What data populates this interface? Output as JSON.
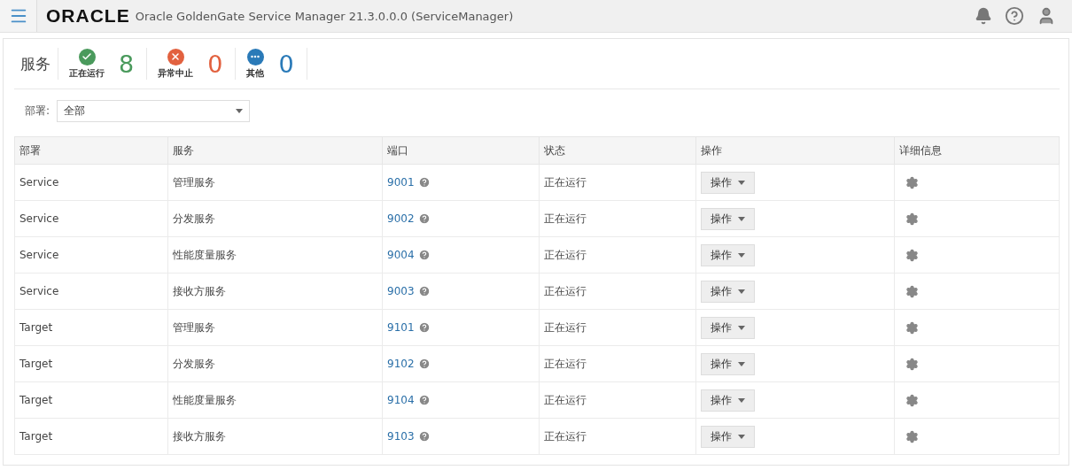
{
  "header": {
    "logo": "ORACLE",
    "title": "Oracle GoldenGate Service Manager 21.3.0.0.0 (ServiceManager)"
  },
  "summary": {
    "title": "服务",
    "items": [
      {
        "kind": "ok",
        "label": "正在运行",
        "count": "8",
        "color": "#4a9a5c"
      },
      {
        "kind": "error",
        "label": "异常中止",
        "count": "0",
        "color": "#e2613f"
      },
      {
        "kind": "other",
        "label": "其他",
        "count": "0",
        "color": "#2a7ab8"
      }
    ]
  },
  "filter": {
    "label": "部署:",
    "value": "全部"
  },
  "table": {
    "columns": [
      "部署",
      "服务",
      "端口",
      "状态",
      "操作",
      "详细信息"
    ],
    "rows": [
      {
        "deployment": "Service",
        "service": "管理服务",
        "port": "9001",
        "status": "正在运行",
        "action": "操作"
      },
      {
        "deployment": "Service",
        "service": "分发服务",
        "port": "9002",
        "status": "正在运行",
        "action": "操作"
      },
      {
        "deployment": "Service",
        "service": "性能度量服务",
        "port": "9004",
        "status": "正在运行",
        "action": "操作"
      },
      {
        "deployment": "Service",
        "service": "接收方服务",
        "port": "9003",
        "status": "正在运行",
        "action": "操作"
      },
      {
        "deployment": "Target",
        "service": "管理服务",
        "port": "9101",
        "status": "正在运行",
        "action": "操作"
      },
      {
        "deployment": "Target",
        "service": "分发服务",
        "port": "9102",
        "status": "正在运行",
        "action": "操作"
      },
      {
        "deployment": "Target",
        "service": "性能度量服务",
        "port": "9104",
        "status": "正在运行",
        "action": "操作"
      },
      {
        "deployment": "Target",
        "service": "接收方服务",
        "port": "9103",
        "status": "正在运行",
        "action": "操作"
      }
    ]
  }
}
